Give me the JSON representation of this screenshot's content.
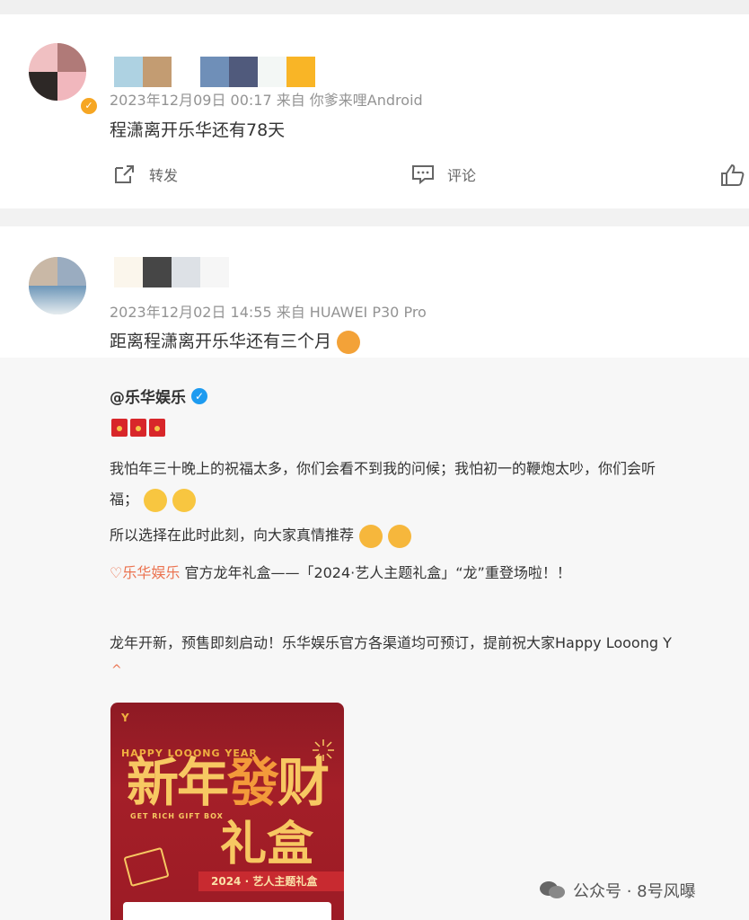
{
  "post1": {
    "meta": "2023年12月09日 00:17  来自 你爹来哩Android",
    "text": "程潇离开乐华还有78天",
    "actions": {
      "repost": "转发",
      "comment": "评论"
    }
  },
  "post2": {
    "meta": "2023年12月02日 14:55  来自 HUAWEI P30 Pro",
    "text": "距离程潇离开乐华还有三个月",
    "repost": {
      "user": "@乐华娱乐",
      "line1": "我怕年三十晚上的祝福太多，你们会看不到我的问候；我怕初一的鞭炮太吵，你们会听",
      "line2": "福；",
      "line3": "所以选择在此时此刻，向大家真情推荐",
      "line4_link": "乐华娱乐",
      "line4_rest": " 官方龙年礼盒——「2024·艺人主题礼盒」“龙”重登场啦！！",
      "line5": "龙年开新，预售即刻启动！乐华娱乐官方各渠道均可预订，提前祝大家Happy Looong Y",
      "caret": "^",
      "poster": {
        "eng_title": "HAPPY LOOONG YEAR",
        "big_title_a": "新年",
        "big_title_b": "發",
        "big_title_c": "财",
        "big_title_2": "礼盒",
        "sub_en": "GET RICH GIFT BOX",
        "bar": "2024 · 艺人主题礼盒"
      }
    }
  },
  "watermark": "公众号 · 8号风曝",
  "colors": {
    "link": "#eb7350",
    "verified": "#1d9bf0",
    "poster_red": "#a41f28",
    "poster_gold": "#f7c862"
  }
}
